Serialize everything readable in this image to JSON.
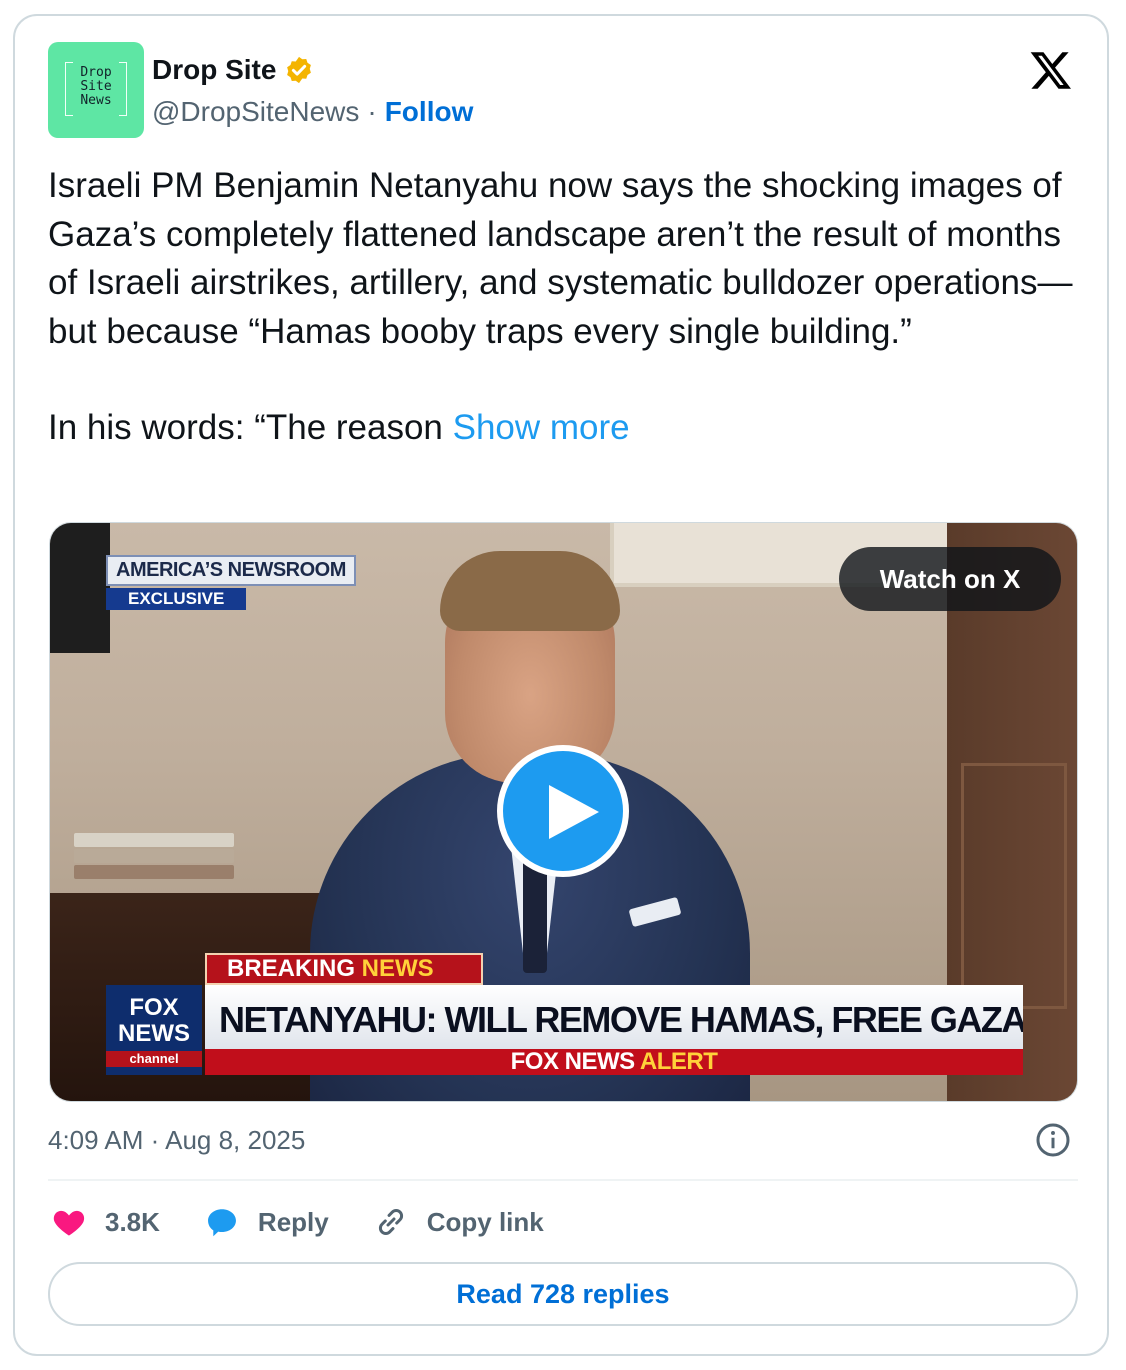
{
  "account": {
    "name": "Drop Site",
    "handle": "@DropSiteNews",
    "separator": "·",
    "follow_label": "Follow",
    "avatar_text": "Drop\nSite\nNews",
    "verified": true,
    "verified_color": "#f4b400"
  },
  "post": {
    "paragraph1": "Israeli PM Benjamin Netanyahu now says the shocking images of Gaza’s completely flattened landscape aren’t the result of months of Israeli airstrikes, artillery, and systematic bulldozer operations—but because “Hamas booby traps every single building.”",
    "paragraph2": "In his words: “The reason ",
    "show_more": "Show more"
  },
  "media": {
    "watch_label": "Watch on X",
    "badge_top": "AMERICA’S NEWSROOM",
    "badge_sub": "EXCLUSIVE",
    "breaking": "BREAKING ",
    "breaking_news": "NEWS",
    "headline": "NETANYAHU: WILL REMOVE HAMAS, FREE GAZA POPULATION",
    "alert_prefix": "FOX NEWS ",
    "alert_word": "ALERT",
    "logo_line1": "FOX",
    "logo_line2": "NEWS",
    "logo_line3": "channel"
  },
  "meta": {
    "time": "4:09 AM",
    "separator": "·",
    "date": "Aug 8, 2025"
  },
  "actions": {
    "like_count": "3.8K",
    "reply_label": "Reply",
    "copy_label": "Copy link"
  },
  "read_replies": "Read 728 replies",
  "colors": {
    "avatar_bg": "#5ee6a4",
    "link": "#006fd6",
    "show_more": "#1d9bf0",
    "like": "#f91880",
    "reply": "#1d9bf0",
    "play": "#1d9bf0"
  },
  "icons": [
    "verified-badge-icon",
    "x-logo-icon",
    "play-icon",
    "info-icon",
    "heart-icon",
    "reply-bubble-icon",
    "link-icon"
  ]
}
